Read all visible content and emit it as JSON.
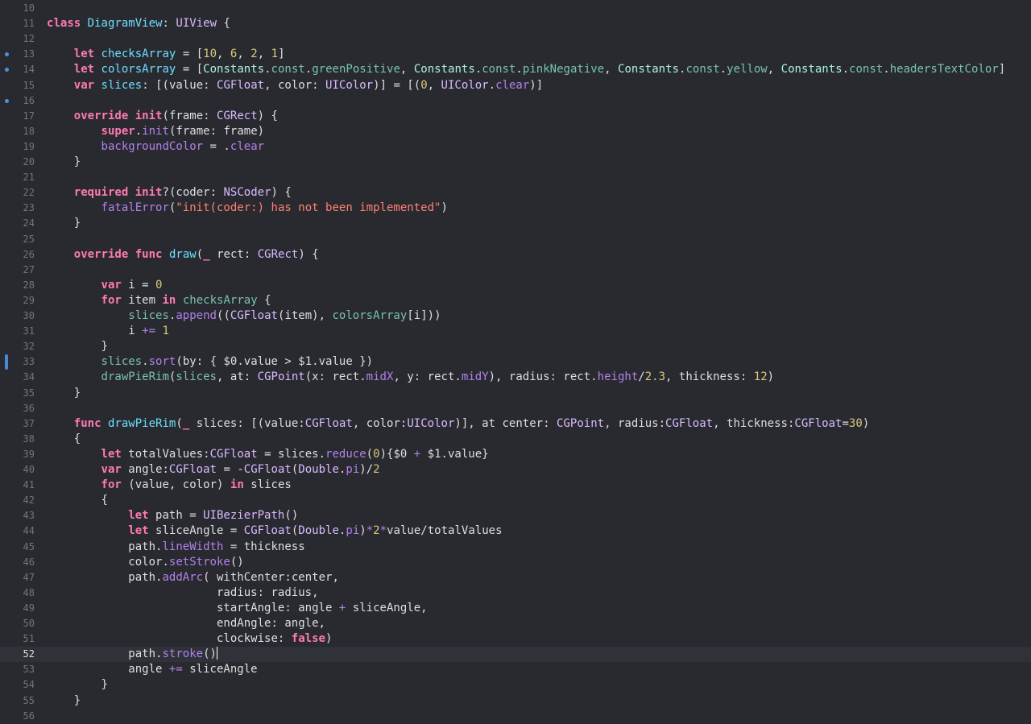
{
  "editor": {
    "language": "Swift",
    "current_line": 52,
    "theme_colors": {
      "background": "#292a30",
      "current_line_bg": "#2f3239",
      "keyword": "#ff7ab2",
      "type": "#dabaff",
      "declaration": "#6bdfff",
      "property": "#b281eb",
      "number": "#d9c97c",
      "string": "#ff8170",
      "plain": "#dfdfe0",
      "line_number": "#747478",
      "marker": "#4a90e2"
    },
    "lines": [
      {
        "n": "10",
        "tokens": []
      },
      {
        "n": "11",
        "tokens": [
          [
            "kw",
            "class"
          ],
          [
            "plain",
            " "
          ],
          [
            "dcl",
            "DiagramView"
          ],
          [
            "plain",
            ": "
          ],
          [
            "ty",
            "UIView"
          ],
          [
            "plain",
            " {"
          ]
        ]
      },
      {
        "n": "12",
        "tokens": []
      },
      {
        "n": "13",
        "tokens": [
          [
            "plain",
            "    "
          ],
          [
            "kw",
            "let"
          ],
          [
            "plain",
            " "
          ],
          [
            "dcl",
            "checksArray"
          ],
          [
            "plain",
            " = ["
          ],
          [
            "num",
            "10"
          ],
          [
            "plain",
            ", "
          ],
          [
            "num",
            "6"
          ],
          [
            "plain",
            ", "
          ],
          [
            "num",
            "2"
          ],
          [
            "plain",
            ", "
          ],
          [
            "num",
            "1"
          ],
          [
            "plain",
            "]"
          ]
        ]
      },
      {
        "n": "14",
        "tokens": [
          [
            "plain",
            "    "
          ],
          [
            "kw",
            "let"
          ],
          [
            "plain",
            " "
          ],
          [
            "dcl",
            "colorsArray"
          ],
          [
            "plain",
            " = ["
          ],
          [
            "cls",
            "Constants"
          ],
          [
            "plain",
            "."
          ],
          [
            "ident",
            "const"
          ],
          [
            "plain",
            "."
          ],
          [
            "ident",
            "greenPositive"
          ],
          [
            "plain",
            ", "
          ],
          [
            "cls",
            "Constants"
          ],
          [
            "plain",
            "."
          ],
          [
            "ident",
            "const"
          ],
          [
            "plain",
            "."
          ],
          [
            "ident",
            "pinkNegative"
          ],
          [
            "plain",
            ", "
          ],
          [
            "cls",
            "Constants"
          ],
          [
            "plain",
            "."
          ],
          [
            "ident",
            "const"
          ],
          [
            "plain",
            "."
          ],
          [
            "ident",
            "yellow"
          ],
          [
            "plain",
            ", "
          ],
          [
            "cls",
            "Constants"
          ],
          [
            "plain",
            "."
          ],
          [
            "ident",
            "const"
          ],
          [
            "plain",
            "."
          ],
          [
            "ident",
            "headersTextColor"
          ],
          [
            "plain",
            "]"
          ]
        ]
      },
      {
        "n": "15",
        "tokens": [
          [
            "plain",
            "    "
          ],
          [
            "kw",
            "var"
          ],
          [
            "plain",
            " "
          ],
          [
            "dcl",
            "slices"
          ],
          [
            "plain",
            ": [(value: "
          ],
          [
            "ty",
            "CGFloat"
          ],
          [
            "plain",
            ", color: "
          ],
          [
            "ty",
            "UIColor"
          ],
          [
            "plain",
            ")] = [("
          ],
          [
            "num",
            "0"
          ],
          [
            "plain",
            ", "
          ],
          [
            "ty",
            "UIColor"
          ],
          [
            "plain",
            "."
          ],
          [
            "prop",
            "clear"
          ],
          [
            "plain",
            ")]"
          ]
        ]
      },
      {
        "n": "16",
        "tokens": []
      },
      {
        "n": "17",
        "tokens": [
          [
            "plain",
            "    "
          ],
          [
            "kw",
            "override"
          ],
          [
            "plain",
            " "
          ],
          [
            "kw",
            "init"
          ],
          [
            "plain",
            "(frame: "
          ],
          [
            "ty",
            "CGRect"
          ],
          [
            "plain",
            ") {"
          ]
        ]
      },
      {
        "n": "18",
        "tokens": [
          [
            "plain",
            "        "
          ],
          [
            "kw",
            "super"
          ],
          [
            "plain",
            "."
          ],
          [
            "prop",
            "init"
          ],
          [
            "plain",
            "(frame: frame)"
          ]
        ]
      },
      {
        "n": "19",
        "tokens": [
          [
            "plain",
            "        "
          ],
          [
            "prop",
            "backgroundColor"
          ],
          [
            "plain",
            " = ."
          ],
          [
            "prop",
            "clear"
          ]
        ]
      },
      {
        "n": "20",
        "tokens": [
          [
            "plain",
            "    }"
          ]
        ]
      },
      {
        "n": "21",
        "tokens": []
      },
      {
        "n": "22",
        "tokens": [
          [
            "plain",
            "    "
          ],
          [
            "kw",
            "required"
          ],
          [
            "plain",
            " "
          ],
          [
            "kw",
            "init"
          ],
          [
            "plain",
            "?(coder: "
          ],
          [
            "ty",
            "NSCoder"
          ],
          [
            "plain",
            ") {"
          ]
        ]
      },
      {
        "n": "23",
        "tokens": [
          [
            "plain",
            "        "
          ],
          [
            "prop",
            "fatalError"
          ],
          [
            "plain",
            "("
          ],
          [
            "str",
            "\"init(coder:) has not been implemented\""
          ],
          [
            "plain",
            ")"
          ]
        ]
      },
      {
        "n": "24",
        "tokens": [
          [
            "plain",
            "    }"
          ]
        ]
      },
      {
        "n": "25",
        "tokens": []
      },
      {
        "n": "26",
        "tokens": [
          [
            "plain",
            "    "
          ],
          [
            "kw",
            "override"
          ],
          [
            "plain",
            " "
          ],
          [
            "kw",
            "func"
          ],
          [
            "plain",
            " "
          ],
          [
            "dcl",
            "draw"
          ],
          [
            "plain",
            "("
          ],
          [
            "kw",
            "_"
          ],
          [
            "plain",
            " rect: "
          ],
          [
            "ty",
            "CGRect"
          ],
          [
            "plain",
            ") {"
          ]
        ]
      },
      {
        "n": "27",
        "tokens": []
      },
      {
        "n": "28",
        "tokens": [
          [
            "plain",
            "        "
          ],
          [
            "kw",
            "var"
          ],
          [
            "plain",
            " i = "
          ],
          [
            "num",
            "0"
          ]
        ]
      },
      {
        "n": "29",
        "tokens": [
          [
            "plain",
            "        "
          ],
          [
            "kw",
            "for"
          ],
          [
            "plain",
            " item "
          ],
          [
            "kw",
            "in"
          ],
          [
            "plain",
            " "
          ],
          [
            "ident",
            "checksArray"
          ],
          [
            "plain",
            " {"
          ]
        ]
      },
      {
        "n": "30",
        "tokens": [
          [
            "plain",
            "            "
          ],
          [
            "ident",
            "slices"
          ],
          [
            "plain",
            "."
          ],
          [
            "prop",
            "append"
          ],
          [
            "plain",
            "(("
          ],
          [
            "ty",
            "CGFloat"
          ],
          [
            "plain",
            "(item), "
          ],
          [
            "ident",
            "colorsArray"
          ],
          [
            "plain",
            "[i]))"
          ]
        ]
      },
      {
        "n": "31",
        "tokens": [
          [
            "plain",
            "            i "
          ],
          [
            "prop",
            "+="
          ],
          [
            "plain",
            " "
          ],
          [
            "num",
            "1"
          ]
        ]
      },
      {
        "n": "32",
        "tokens": [
          [
            "plain",
            "        }"
          ]
        ]
      },
      {
        "n": "33",
        "tokens": [
          [
            "plain",
            "        "
          ],
          [
            "ident",
            "slices"
          ],
          [
            "plain",
            "."
          ],
          [
            "prop",
            "sort"
          ],
          [
            "plain",
            "(by: { $0.value > $1.value })"
          ]
        ]
      },
      {
        "n": "34",
        "tokens": [
          [
            "plain",
            "        "
          ],
          [
            "ident",
            "drawPieRim"
          ],
          [
            "plain",
            "("
          ],
          [
            "ident",
            "slices"
          ],
          [
            "plain",
            ", at: "
          ],
          [
            "ty",
            "CGPoint"
          ],
          [
            "plain",
            "(x: rect."
          ],
          [
            "prop",
            "midX"
          ],
          [
            "plain",
            ", y: rect."
          ],
          [
            "prop",
            "midY"
          ],
          [
            "plain",
            "), radius: rect."
          ],
          [
            "prop",
            "height"
          ],
          [
            "plain",
            "/"
          ],
          [
            "num",
            "2.3"
          ],
          [
            "plain",
            ", thickness: "
          ],
          [
            "num",
            "12"
          ],
          [
            "plain",
            ")"
          ]
        ]
      },
      {
        "n": "35",
        "tokens": [
          [
            "plain",
            "    }"
          ]
        ]
      },
      {
        "n": "36",
        "tokens": []
      },
      {
        "n": "37",
        "tokens": [
          [
            "plain",
            "    "
          ],
          [
            "kw",
            "func"
          ],
          [
            "plain",
            " "
          ],
          [
            "dcl",
            "drawPieRim"
          ],
          [
            "plain",
            "("
          ],
          [
            "kw",
            "_"
          ],
          [
            "plain",
            " slices: [(value:"
          ],
          [
            "ty",
            "CGFloat"
          ],
          [
            "plain",
            ", color:"
          ],
          [
            "ty",
            "UIColor"
          ],
          [
            "plain",
            ")], at center: "
          ],
          [
            "ty",
            "CGPoint"
          ],
          [
            "plain",
            ", radius:"
          ],
          [
            "ty",
            "CGFloat"
          ],
          [
            "plain",
            ", thickness:"
          ],
          [
            "ty",
            "CGFloat"
          ],
          [
            "plain",
            "="
          ],
          [
            "num",
            "30"
          ],
          [
            "plain",
            ")"
          ]
        ]
      },
      {
        "n": "38",
        "tokens": [
          [
            "plain",
            "    {"
          ]
        ]
      },
      {
        "n": "39",
        "tokens": [
          [
            "plain",
            "        "
          ],
          [
            "kw",
            "let"
          ],
          [
            "plain",
            " totalValues:"
          ],
          [
            "ty",
            "CGFloat"
          ],
          [
            "plain",
            " = slices."
          ],
          [
            "prop",
            "reduce"
          ],
          [
            "plain",
            "("
          ],
          [
            "num",
            "0"
          ],
          [
            "plain",
            "){$0 "
          ],
          [
            "prop",
            "+"
          ],
          [
            "plain",
            " $1.value}"
          ]
        ]
      },
      {
        "n": "40",
        "tokens": [
          [
            "plain",
            "        "
          ],
          [
            "kw",
            "var"
          ],
          [
            "plain",
            " angle:"
          ],
          [
            "ty",
            "CGFloat"
          ],
          [
            "plain",
            " = -"
          ],
          [
            "ty",
            "CGFloat"
          ],
          [
            "plain",
            "("
          ],
          [
            "ty",
            "Double"
          ],
          [
            "plain",
            "."
          ],
          [
            "prop",
            "pi"
          ],
          [
            "plain",
            ")/"
          ],
          [
            "num",
            "2"
          ]
        ]
      },
      {
        "n": "41",
        "tokens": [
          [
            "plain",
            "        "
          ],
          [
            "kw",
            "for"
          ],
          [
            "plain",
            " (value, color) "
          ],
          [
            "kw",
            "in"
          ],
          [
            "plain",
            " slices"
          ]
        ]
      },
      {
        "n": "42",
        "tokens": [
          [
            "plain",
            "        {"
          ]
        ]
      },
      {
        "n": "43",
        "tokens": [
          [
            "plain",
            "            "
          ],
          [
            "kw",
            "let"
          ],
          [
            "plain",
            " path = "
          ],
          [
            "ty",
            "UIBezierPath"
          ],
          [
            "plain",
            "()"
          ]
        ]
      },
      {
        "n": "44",
        "tokens": [
          [
            "plain",
            "            "
          ],
          [
            "kw",
            "let"
          ],
          [
            "plain",
            " sliceAngle = "
          ],
          [
            "ty",
            "CGFloat"
          ],
          [
            "plain",
            "("
          ],
          [
            "ty",
            "Double"
          ],
          [
            "plain",
            "."
          ],
          [
            "prop",
            "pi"
          ],
          [
            "plain",
            ")"
          ],
          [
            "prop",
            "*"
          ],
          [
            "num",
            "2"
          ],
          [
            "prop",
            "*"
          ],
          [
            "plain",
            "value/totalValues"
          ]
        ]
      },
      {
        "n": "45",
        "tokens": [
          [
            "plain",
            "            path."
          ],
          [
            "prop",
            "lineWidth"
          ],
          [
            "plain",
            " = thickness"
          ]
        ]
      },
      {
        "n": "46",
        "tokens": [
          [
            "plain",
            "            color."
          ],
          [
            "prop",
            "setStroke"
          ],
          [
            "plain",
            "()"
          ]
        ]
      },
      {
        "n": "47",
        "tokens": [
          [
            "plain",
            "            path."
          ],
          [
            "prop",
            "addArc"
          ],
          [
            "plain",
            "( withCenter:center,"
          ]
        ]
      },
      {
        "n": "48",
        "tokens": [
          [
            "plain",
            "                         radius: radius,"
          ]
        ]
      },
      {
        "n": "49",
        "tokens": [
          [
            "plain",
            "                         startAngle: angle "
          ],
          [
            "prop",
            "+"
          ],
          [
            "plain",
            " sliceAngle,"
          ]
        ]
      },
      {
        "n": "50",
        "tokens": [
          [
            "plain",
            "                         endAngle: angle,"
          ]
        ]
      },
      {
        "n": "51",
        "tokens": [
          [
            "plain",
            "                         clockwise: "
          ],
          [
            "kw",
            "false"
          ],
          [
            "plain",
            ")"
          ]
        ]
      },
      {
        "n": "52",
        "tokens": [
          [
            "plain",
            "            path."
          ],
          [
            "prop",
            "stroke"
          ],
          [
            "plain",
            "()"
          ]
        ]
      },
      {
        "n": "53",
        "tokens": [
          [
            "plain",
            "            angle "
          ],
          [
            "prop",
            "+="
          ],
          [
            "plain",
            " sliceAngle"
          ]
        ]
      },
      {
        "n": "54",
        "tokens": [
          [
            "plain",
            "        }"
          ]
        ]
      },
      {
        "n": "55",
        "tokens": [
          [
            "plain",
            "    }"
          ]
        ]
      },
      {
        "n": "56",
        "tokens": []
      }
    ],
    "gutter_markers": [
      {
        "line": "13",
        "kind": "change-dot"
      },
      {
        "line": "14",
        "kind": "change-dot"
      },
      {
        "line": "16",
        "kind": "change-dot"
      },
      {
        "line": "33",
        "kind": "change-bar"
      }
    ]
  }
}
